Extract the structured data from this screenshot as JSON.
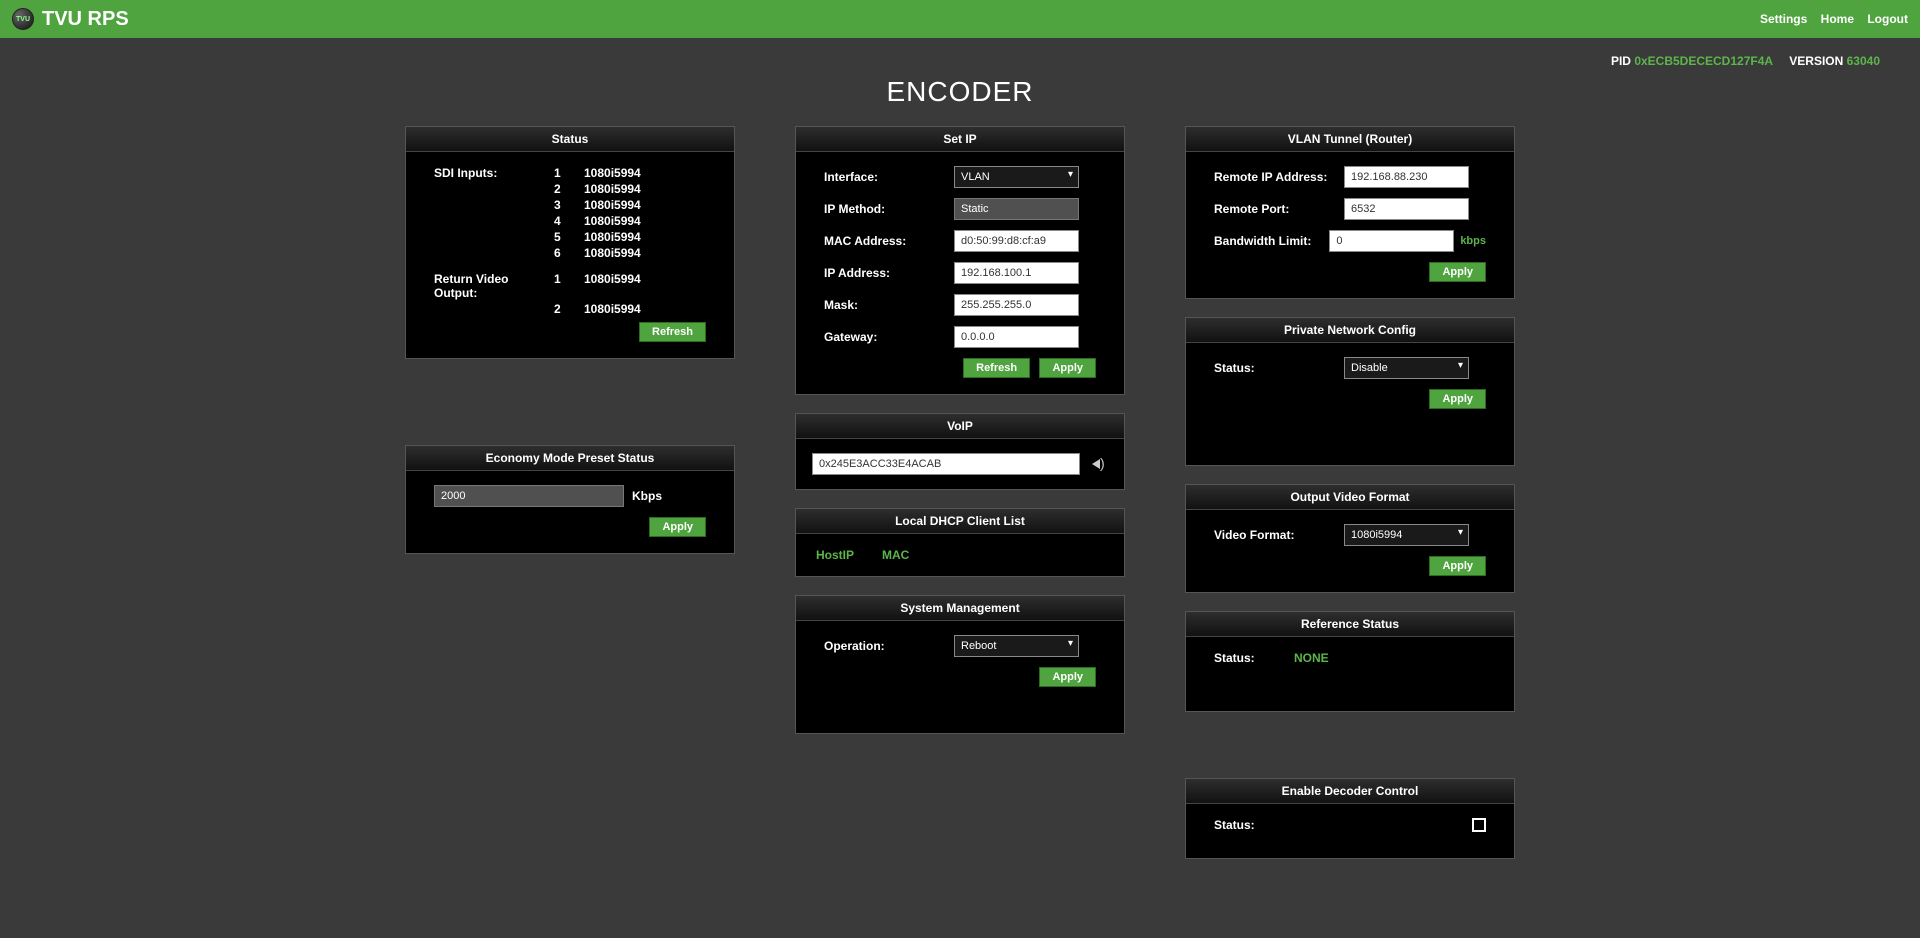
{
  "header": {
    "app_title": "TVU RPS",
    "nav": {
      "settings": "Settings",
      "home": "Home",
      "logout": "Logout"
    }
  },
  "meta": {
    "pid_label": "PID",
    "pid_value": "0xECB5DECECD127F4A",
    "version_label": "VERSION",
    "version_value": "63040"
  },
  "page_title": "ENCODER",
  "buttons": {
    "refresh": "Refresh",
    "apply": "Apply"
  },
  "status": {
    "title": "Status",
    "sdi_label": "SDI Inputs:",
    "sdi": [
      {
        "idx": "1",
        "fmt": "1080i5994"
      },
      {
        "idx": "2",
        "fmt": "1080i5994"
      },
      {
        "idx": "3",
        "fmt": "1080i5994"
      },
      {
        "idx": "4",
        "fmt": "1080i5994"
      },
      {
        "idx": "5",
        "fmt": "1080i5994"
      },
      {
        "idx": "6",
        "fmt": "1080i5994"
      }
    ],
    "rvo_label": "Return Video Output:",
    "rvo": [
      {
        "idx": "1",
        "fmt": "1080i5994"
      },
      {
        "idx": "2",
        "fmt": "1080i5994"
      }
    ]
  },
  "economy": {
    "title": "Economy Mode Preset Status",
    "value": "2000",
    "unit": "Kbps"
  },
  "setip": {
    "title": "Set IP",
    "interface_label": "Interface:",
    "interface_value": "VLAN",
    "method_label": "IP Method:",
    "method_value": "Static",
    "mac_label": "MAC Address:",
    "mac_value": "d0:50:99:d8:cf:a9",
    "ip_label": "IP Address:",
    "ip_value": "192.168.100.1",
    "mask_label": "Mask:",
    "mask_value": "255.255.255.0",
    "gw_label": "Gateway:",
    "gw_value": "0.0.0.0"
  },
  "voip": {
    "title": "VoIP",
    "value": "0x245E3ACC33E4ACAB"
  },
  "dhcp": {
    "title": "Local DHCP Client List",
    "col1": "HostIP",
    "col2": "MAC"
  },
  "sysmgmt": {
    "title": "System Management",
    "op_label": "Operation:",
    "op_value": "Reboot"
  },
  "vlan": {
    "title": "VLAN Tunnel (Router)",
    "rip_label": "Remote IP Address:",
    "rip_value": "192.168.88.230",
    "rport_label": "Remote Port:",
    "rport_value": "6532",
    "bw_label": "Bandwidth Limit:",
    "bw_value": "0",
    "bw_unit": "kbps"
  },
  "pnc": {
    "title": "Private Network Config",
    "status_label": "Status:",
    "status_value": "Disable"
  },
  "ovf": {
    "title": "Output Video Format",
    "label": "Video Format:",
    "value": "1080i5994"
  },
  "refstat": {
    "title": "Reference Status",
    "label": "Status:",
    "value": "NONE"
  },
  "edc": {
    "title": "Enable Decoder Control",
    "label": "Status:"
  }
}
